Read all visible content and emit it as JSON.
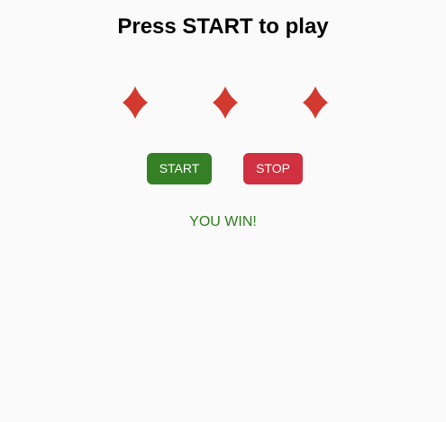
{
  "header": {
    "title": "Press START to play"
  },
  "reels": [
    {
      "symbol": "diamond-icon"
    },
    {
      "symbol": "diamond-icon"
    },
    {
      "symbol": "diamond-icon"
    }
  ],
  "controls": {
    "start_label": "START",
    "stop_label": "STOP"
  },
  "status": {
    "message": "YOU WIN!"
  },
  "colors": {
    "background": "#fafafa",
    "diamond": "#d23a2f",
    "start_button": "#357f25",
    "stop_button": "#d03040",
    "win_text": "#2c7d1d"
  }
}
